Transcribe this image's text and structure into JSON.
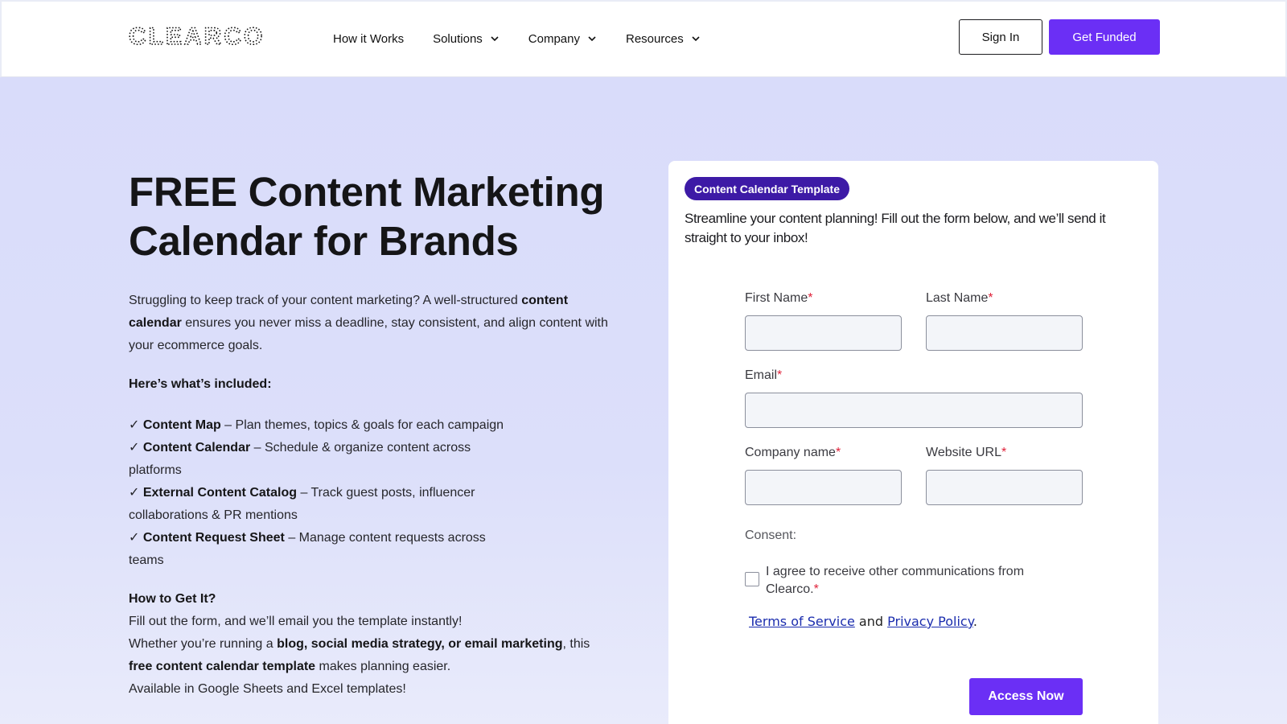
{
  "header": {
    "logo_text": "CLEARCO",
    "nav": [
      {
        "label": "How it Works",
        "has_dropdown": false
      },
      {
        "label": "Solutions",
        "has_dropdown": true
      },
      {
        "label": "Company",
        "has_dropdown": true
      },
      {
        "label": "Resources",
        "has_dropdown": true
      }
    ],
    "signin_label": "Sign In",
    "funded_label": "Get Funded"
  },
  "hero": {
    "title_line1": "FREE Content Marketing",
    "title_line2": "Calendar for Brands",
    "intro_pre": "Struggling to keep track of your content marketing? A well-structured ",
    "intro_bold": "content calendar",
    "intro_post": " ensures you never miss a deadline, stay consistent, and align content with your ecommerce goals.",
    "included_heading": "Here’s what’s included:",
    "items": [
      {
        "check": "✓",
        "name": "Content Map",
        "desc": " – Plan themes, topics & goals for each campaign"
      },
      {
        "check": "✓",
        "name": "Content Calendar",
        "desc": " – Schedule & organize content across platforms"
      },
      {
        "check": "✓",
        "name": "External Content Catalog",
        "desc": " – Track guest posts, influencer collaborations & PR mentions"
      },
      {
        "check": "✓",
        "name": "Content Request Sheet",
        "desc": " – Manage content requests across teams"
      }
    ],
    "howto_heading": "How to Get It?",
    "howto_line1": "Fill out the form, and we’ll email you the template instantly!",
    "howto_line2_pre": "Whether you’re running a ",
    "howto_line2_bold": "blog, social media strategy, or email marketing",
    "howto_line2_post": ", this",
    "howto_line3_bold": "free content calendar template",
    "howto_line3_post": " makes planning easier.",
    "howto_line4": "Available in Google Sheets and Excel templates!"
  },
  "form": {
    "badge": "Content Calendar Template",
    "subtitle": "Streamline your content planning! Fill out the form below, and we’ll send it straight to your inbox!",
    "first_name_label": "First Name",
    "last_name_label": "Last Name",
    "email_label": "Email",
    "company_label": "Company name",
    "website_label": "Website URL",
    "required_mark": "*",
    "first_name_value": "",
    "last_name_value": "",
    "email_value": "",
    "company_value": "",
    "website_value": "",
    "consent_label": "Consent:",
    "agree_text": "I agree to receive other communications from Clearco.",
    "consent_checked": false,
    "terms_label": "Terms of Service",
    "and_text": " and ",
    "privacy_label": "Privacy Policy",
    "period": ".",
    "submit_label": "Access Now"
  },
  "colors": {
    "brand_purple": "#6b2ff5",
    "badge_purple": "#3d1aa6",
    "hero_bg": "#dadcf9",
    "required_red": "#e0223a"
  }
}
